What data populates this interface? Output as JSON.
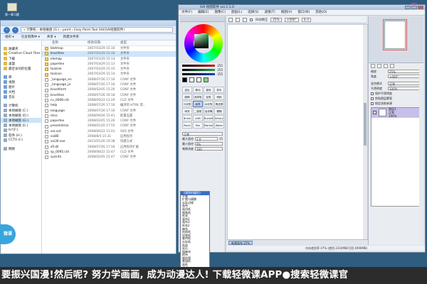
{
  "desktop": {
    "icon_label": "第一章习题",
    "icon2_label": ""
  },
  "explorer": {
    "address": "« 计算机 › 本地磁盘 (G:) › paint › Easy Paint Tool SAI(SAI绘图软件)",
    "toolbar": [
      "组织 ▾",
      "包含到库中 ▾",
      "共享 ▾",
      "新建文件夹"
    ],
    "columns": {
      "name": "名称",
      "date": "修改日期",
      "type": "类型"
    },
    "nav_items": [
      {
        "label": "收藏夹",
        "kind": "fav"
      },
      {
        "label": "Creative Cloud Files",
        "kind": "fav"
      },
      {
        "label": "下载",
        "kind": "fav"
      },
      {
        "label": "桌面",
        "kind": "fav"
      },
      {
        "label": "最近访问的位置",
        "kind": "fav"
      },
      {
        "label": "",
        "kind": "gap"
      },
      {
        "label": "库",
        "kind": "lib"
      },
      {
        "label": "视频",
        "kind": "lib"
      },
      {
        "label": "图片",
        "kind": "lib"
      },
      {
        "label": "文档",
        "kind": "lib"
      },
      {
        "label": "音乐",
        "kind": "lib"
      },
      {
        "label": "",
        "kind": "gap"
      },
      {
        "label": "计算机",
        "kind": "drive"
      },
      {
        "label": "本地磁盘 (C:)",
        "kind": "drive"
      },
      {
        "label": "本地磁盘 (D:)",
        "kind": "drive"
      },
      {
        "label": "本地磁盘 (G:)",
        "kind": "drive",
        "selected": true
      },
      {
        "label": "本地磁盘 (E:)",
        "kind": "drive"
      },
      {
        "label": "ts*(F:)",
        "kind": "drive"
      },
      {
        "label": "软件 (H:)",
        "kind": "drive"
      },
      {
        "label": "CCTV (I:)",
        "kind": "drive"
      },
      {
        "label": "",
        "kind": "gap"
      },
      {
        "label": "网络",
        "kind": "drive"
      }
    ],
    "files": [
      {
        "name": "blotmap",
        "date": "2007/03/29 15:16",
        "type": "文件夹",
        "doc": false
      },
      {
        "name": "brushtex",
        "date": "2007/03/29 15:16",
        "type": "文件夹",
        "doc": false,
        "selected": true
      },
      {
        "name": "elemap",
        "date": "2007/03/29 15:14",
        "type": "文件夹",
        "doc": false
      },
      {
        "name": "papertex",
        "date": "2007/03/29 15:13",
        "type": "文件夹",
        "doc": false
      },
      {
        "name": "toolsnk",
        "date": "2007/03/29 15:15",
        "type": "文件夹",
        "doc": false
      },
      {
        "name": "toolcon",
        "date": "2007/03/29 15:14",
        "type": "文件夹",
        "doc": false
      },
      {
        "name": "_language_en",
        "date": "2008/07/26 17:16",
        "type": "CONF 文件",
        "doc": true
      },
      {
        "name": "_language_ja",
        "date": "2008/07/26 17:16",
        "type": "CONF 文件",
        "doc": true
      },
      {
        "name": "brushform",
        "date": "2008/02/05 15:26",
        "type": "CONF 文件",
        "doc": true
      },
      {
        "name": "brushtex",
        "date": "2008/07/26 16:18",
        "type": "CONF 文件",
        "doc": true
      },
      {
        "name": "cv_0008.cld",
        "date": "2008/09/22 11:20",
        "type": "CLD 文件",
        "doc": true
      },
      {
        "name": "help",
        "date": "2008/07/26 17:16",
        "type": "编译的 HTML 帮...",
        "doc": true
      },
      {
        "name": "language",
        "date": "2008/07/26 17:16",
        "type": "CONF 文件",
        "doc": true
      },
      {
        "name": "misc",
        "date": "2008/09/26 15:41",
        "type": "配置设置",
        "doc": true
      },
      {
        "name": "papertex",
        "date": "2008/02/05 15:26",
        "type": "CONF 文件",
        "doc": true
      },
      {
        "name": "presetstrize",
        "date": "2008/01/20 17:55",
        "type": "CONF 文件",
        "doc": true
      },
      {
        "name": "sai.ssd",
        "date": "2008/09/22 11:01",
        "type": "SSD 文件",
        "doc": true
      },
      {
        "name": "sai80",
        "date": "2008/8/4 15:31",
        "type": "应用程序",
        "doc": true
      },
      {
        "name": "sai30.exe",
        "date": "2015/01/26 19:38",
        "type": "快捷方式",
        "doc": true
      },
      {
        "name": "sfl.dll",
        "date": "2008/07/26 17:16",
        "type": "应用程序扩展",
        "doc": true
      },
      {
        "name": "sp_0095.cld",
        "date": "2008/08/22 15:47",
        "type": "CLD 文件",
        "doc": true
      },
      {
        "name": "sysinfo",
        "date": "2008/02/05 15:47",
        "type": "CONF 文件",
        "doc": true
      }
    ]
  },
  "sai": {
    "title": "SAI 绘图软件 ver.1.1.0",
    "menu": [
      "文件(F)",
      "编辑(E)",
      "图像(C)",
      "图层(L)",
      "选择(S)",
      "滤镜(T)",
      "视图(V)",
      "窗口(W)",
      "其他(O)"
    ],
    "toolbar": {
      "zoom": "25%",
      "angle": "+000°",
      "stabilizer_label": "抖动修正",
      "stabilizer": "S-3"
    },
    "sliders": [
      {
        "color": "#d22020",
        "value": "255"
      },
      {
        "color": "#22a040",
        "value": "255"
      },
      {
        "color": "#2040c8",
        "value": "255"
      }
    ],
    "swatches": [
      "#000000",
      "#ffffff",
      "#ffffff",
      "#7fd07f"
    ],
    "tools": [
      "选区",
      "移动",
      "旋转",
      "抓手",
      "魔棒",
      "选择笔",
      "铅笔",
      "喷枪",
      "马克笔",
      "画笔",
      "水彩笔",
      "橡皮擦",
      "喷漆",
      "二值笔",
      "油漆桶",
      "模糊",
      "Brush",
      "AirB",
      "Bucket",
      "Binary",
      "Pencil",
      "Pen",
      "Marker",
      "Water"
    ],
    "brush_params": {
      "mode_label": "正常",
      "size_label": "最大直径",
      "size_value": "1.0",
      "size_max": "15",
      "min_label": "最小直径",
      "min_value": "0%",
      "density_label": "笔刷浓度",
      "density_value": "100"
    },
    "brush_shapes": [
      "《通常的圆形》",
      "平笔",
      "扩散与模糊",
      "水彩边缘",
      "画布",
      "画用纸",
      "钢笔纸",
      "纸张",
      "画布2",
      "画布3",
      "纸张2",
      "麻布",
      "绘图纸",
      "铅笔纸",
      "鲁特纸",
      "水彩纸",
      "纸纹",
      "岩石",
      "粗麻布",
      "帆布",
      "细纹理",
      "素描纸",
      "画纸",
      "粗纸",
      "布纹",
      "宣纸",
      "草纸",
      "皮革"
    ],
    "canvas_tab": "新建画布",
    "canvas_tab_zoom": "25%",
    "status": "内存使用率 47% (使用 2316MB/可用 4096MB)",
    "layer_panel": {
      "mode_label": "混合模式",
      "mode_value": "正常",
      "opacity_label": "不透明度",
      "opacity_value": "100%",
      "protect_label": "保护不透明度",
      "clip_label": "剪贴图层蒙版",
      "select_label": "指定选取来源",
      "layer_name": "图层1",
      "layer_mode": "正常",
      "layer_opacity": "100%"
    },
    "nav_labels": [
      "缩放",
      "角度",
      "翻转"
    ]
  },
  "overlay": {
    "bubble_text": "微课",
    "subtitle": "要振兴国漫!然后呢? 努力学画画, 成为动漫达人! 下载轻微课APP●搜索轻微课官"
  }
}
